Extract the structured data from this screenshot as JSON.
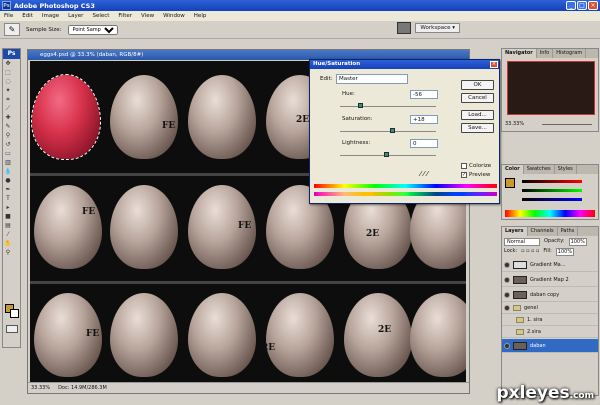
{
  "app": {
    "title": "Adobe Photoshop CS3"
  },
  "menu": [
    "File",
    "Edit",
    "Image",
    "Layer",
    "Select",
    "Filter",
    "View",
    "Window",
    "Help"
  ],
  "options": {
    "sample_label": "Sample Size:",
    "sample_value": "Point Sample",
    "workspace": "Workspace ▾"
  },
  "document": {
    "title": "eggs4.psd @ 33.3% (daban, RGB/8#)",
    "zoom": "33.33%",
    "docsize": "Doc: 14.9M/286.3M",
    "labels": [
      "FE",
      "2E",
      "FE",
      "2E",
      "FE",
      "2E",
      "FE",
      "2E"
    ]
  },
  "dialog": {
    "title": "Hue/Saturation",
    "edit_label": "Edit:",
    "edit_value": "Master",
    "hue_label": "Hue:",
    "hue_value": "-56",
    "sat_label": "Saturation:",
    "sat_value": "+18",
    "light_label": "Lightness:",
    "light_value": "0",
    "ok": "OK",
    "cancel": "Cancel",
    "load": "Load...",
    "save": "Save...",
    "colorize": "Colorize",
    "preview": "Preview"
  },
  "navigator": {
    "tabs": [
      "Navigator",
      "Info",
      "Histogram"
    ],
    "zoom": "33.33%"
  },
  "color": {
    "tabs": [
      "Color",
      "Swatches",
      "Styles"
    ]
  },
  "layers": {
    "tabs": [
      "Layers",
      "Channels",
      "Paths"
    ],
    "blend": "Normal",
    "opacity_label": "Opacity:",
    "opacity_value": "100%",
    "lock_label": "Lock:",
    "fill_label": "Fill:",
    "fill_value": "100%",
    "rows": [
      "Gradient Ma...",
      "Gradient Map 2",
      "daban copy",
      "genel",
      "1. sira",
      "2.sira",
      "daban"
    ]
  },
  "watermark": {
    "text": "pxleyes",
    "suffix": ".com"
  },
  "colors": {
    "accent": "#316ac5",
    "titlebar": "#1440b8",
    "egg_selected": "#d8324c"
  }
}
